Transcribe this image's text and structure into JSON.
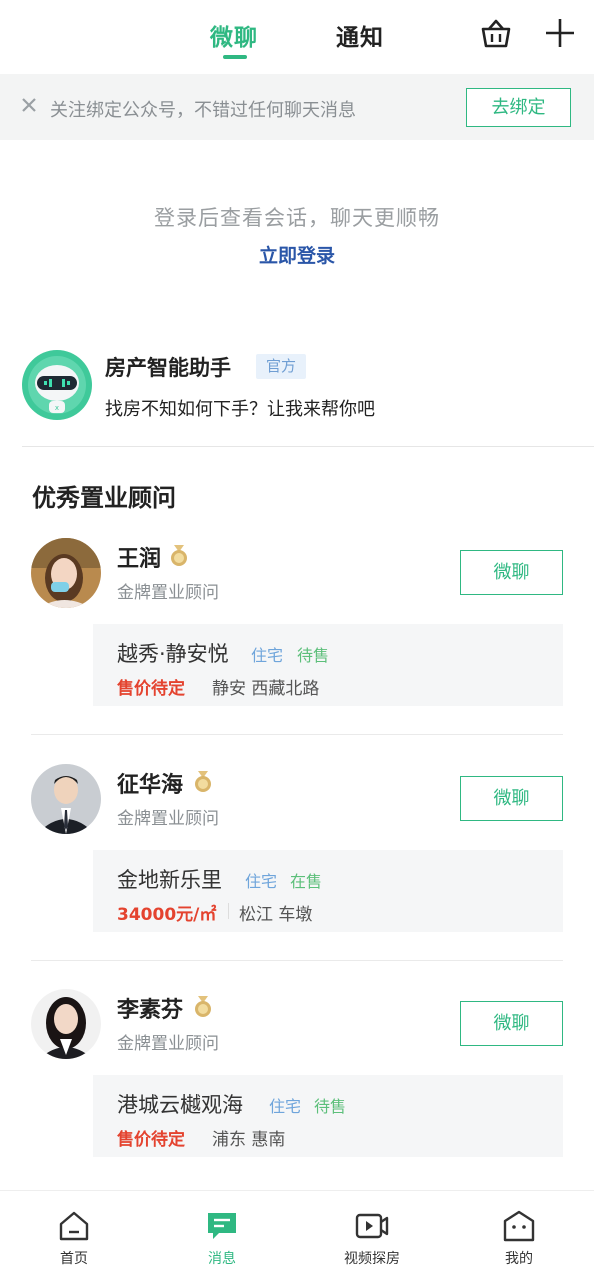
{
  "header": {
    "tabs": [
      {
        "label": "微聊",
        "active": true
      },
      {
        "label": "通知",
        "active": false
      }
    ],
    "icons": [
      "basket-icon",
      "plus-icon"
    ],
    "accent_color": "#2fb882"
  },
  "banner": {
    "text": "关注绑定公众号，不错过任何聊天消息",
    "button_label": "去绑定"
  },
  "login": {
    "tip": "登录后查看会话，聊天更顺畅",
    "link": "立即登录"
  },
  "assistant": {
    "name": "房产智能助手",
    "badge": "官方",
    "message": "找房不知如何下手？让我来帮你吧"
  },
  "section": {
    "title": "优秀置业顾问"
  },
  "agents": [
    {
      "name": "王润",
      "title": "金牌置业顾问",
      "button": "微聊",
      "listing": {
        "name": "越秀·静安悦",
        "type": "住宅",
        "status": "待售",
        "price": "售价待定",
        "location": "静安 西藏北路"
      }
    },
    {
      "name": "征华海",
      "title": "金牌置业顾问",
      "button": "微聊",
      "listing": {
        "name": "金地新乐里",
        "type": "住宅",
        "status": "在售",
        "price": "34000元/㎡",
        "location": "松江 车墩"
      }
    },
    {
      "name": "李素芬",
      "title": "金牌置业顾问",
      "button": "微聊",
      "listing": {
        "name": "港城云樾观海",
        "type": "住宅",
        "status": "待售",
        "price": "售价待定",
        "location": "浦东 惠南"
      }
    }
  ],
  "bottom_nav": [
    {
      "label": "首页",
      "icon": "home-icon",
      "active": false
    },
    {
      "label": "消息",
      "icon": "message-icon",
      "active": true
    },
    {
      "label": "视频探房",
      "icon": "video-icon",
      "active": false
    },
    {
      "label": "我的",
      "icon": "profile-icon",
      "active": false
    }
  ]
}
